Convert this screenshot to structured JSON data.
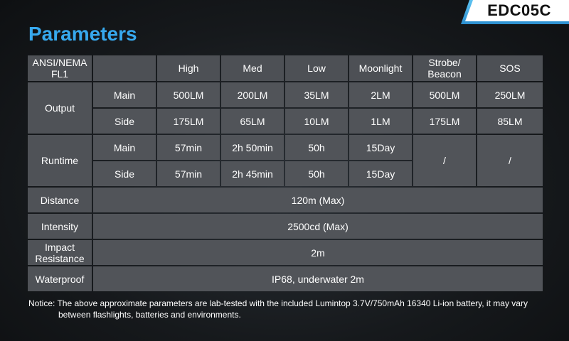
{
  "model": "EDC05C",
  "title": "Parameters",
  "header": {
    "standard": "ANSI/NEMA FL1",
    "modes": [
      "High",
      "Med",
      "Low",
      "Moonlight",
      "Strobe/ Beacon",
      "SOS"
    ]
  },
  "output": {
    "label": "Output",
    "main": {
      "label": "Main",
      "values": [
        "500LM",
        "200LM",
        "35LM",
        "2LM",
        "500LM",
        "250LM"
      ]
    },
    "side": {
      "label": "Side",
      "values": [
        "175LM",
        "65LM",
        "10LM",
        "1LM",
        "175LM",
        "85LM"
      ]
    }
  },
  "runtime": {
    "label": "Runtime",
    "main": {
      "label": "Main",
      "values": [
        "57min",
        "2h 50min",
        "50h",
        "15Day"
      ]
    },
    "side": {
      "label": "Side",
      "values": [
        "57min",
        "2h 45min",
        "50h",
        "15Day"
      ]
    },
    "strobe": "/",
    "sos": "/"
  },
  "distance": {
    "label": "Distance",
    "value": "120m (Max)"
  },
  "intensity": {
    "label": "Intensity",
    "value": "2500cd (Max)"
  },
  "impact": {
    "label": "Impact Resistance",
    "value": "2m"
  },
  "waterproof": {
    "label": "Waterproof",
    "value": "IP68, underwater 2m"
  },
  "notice": "Notice: The above approximate parameters are lab-tested with the included Lumintop 3.7V/750mAh 16340 Li-ion battery, it may vary between flashlights, batteries and environments.",
  "colors": {
    "accent": "#37a9ee",
    "cell": "#515459",
    "background": "#121518"
  }
}
